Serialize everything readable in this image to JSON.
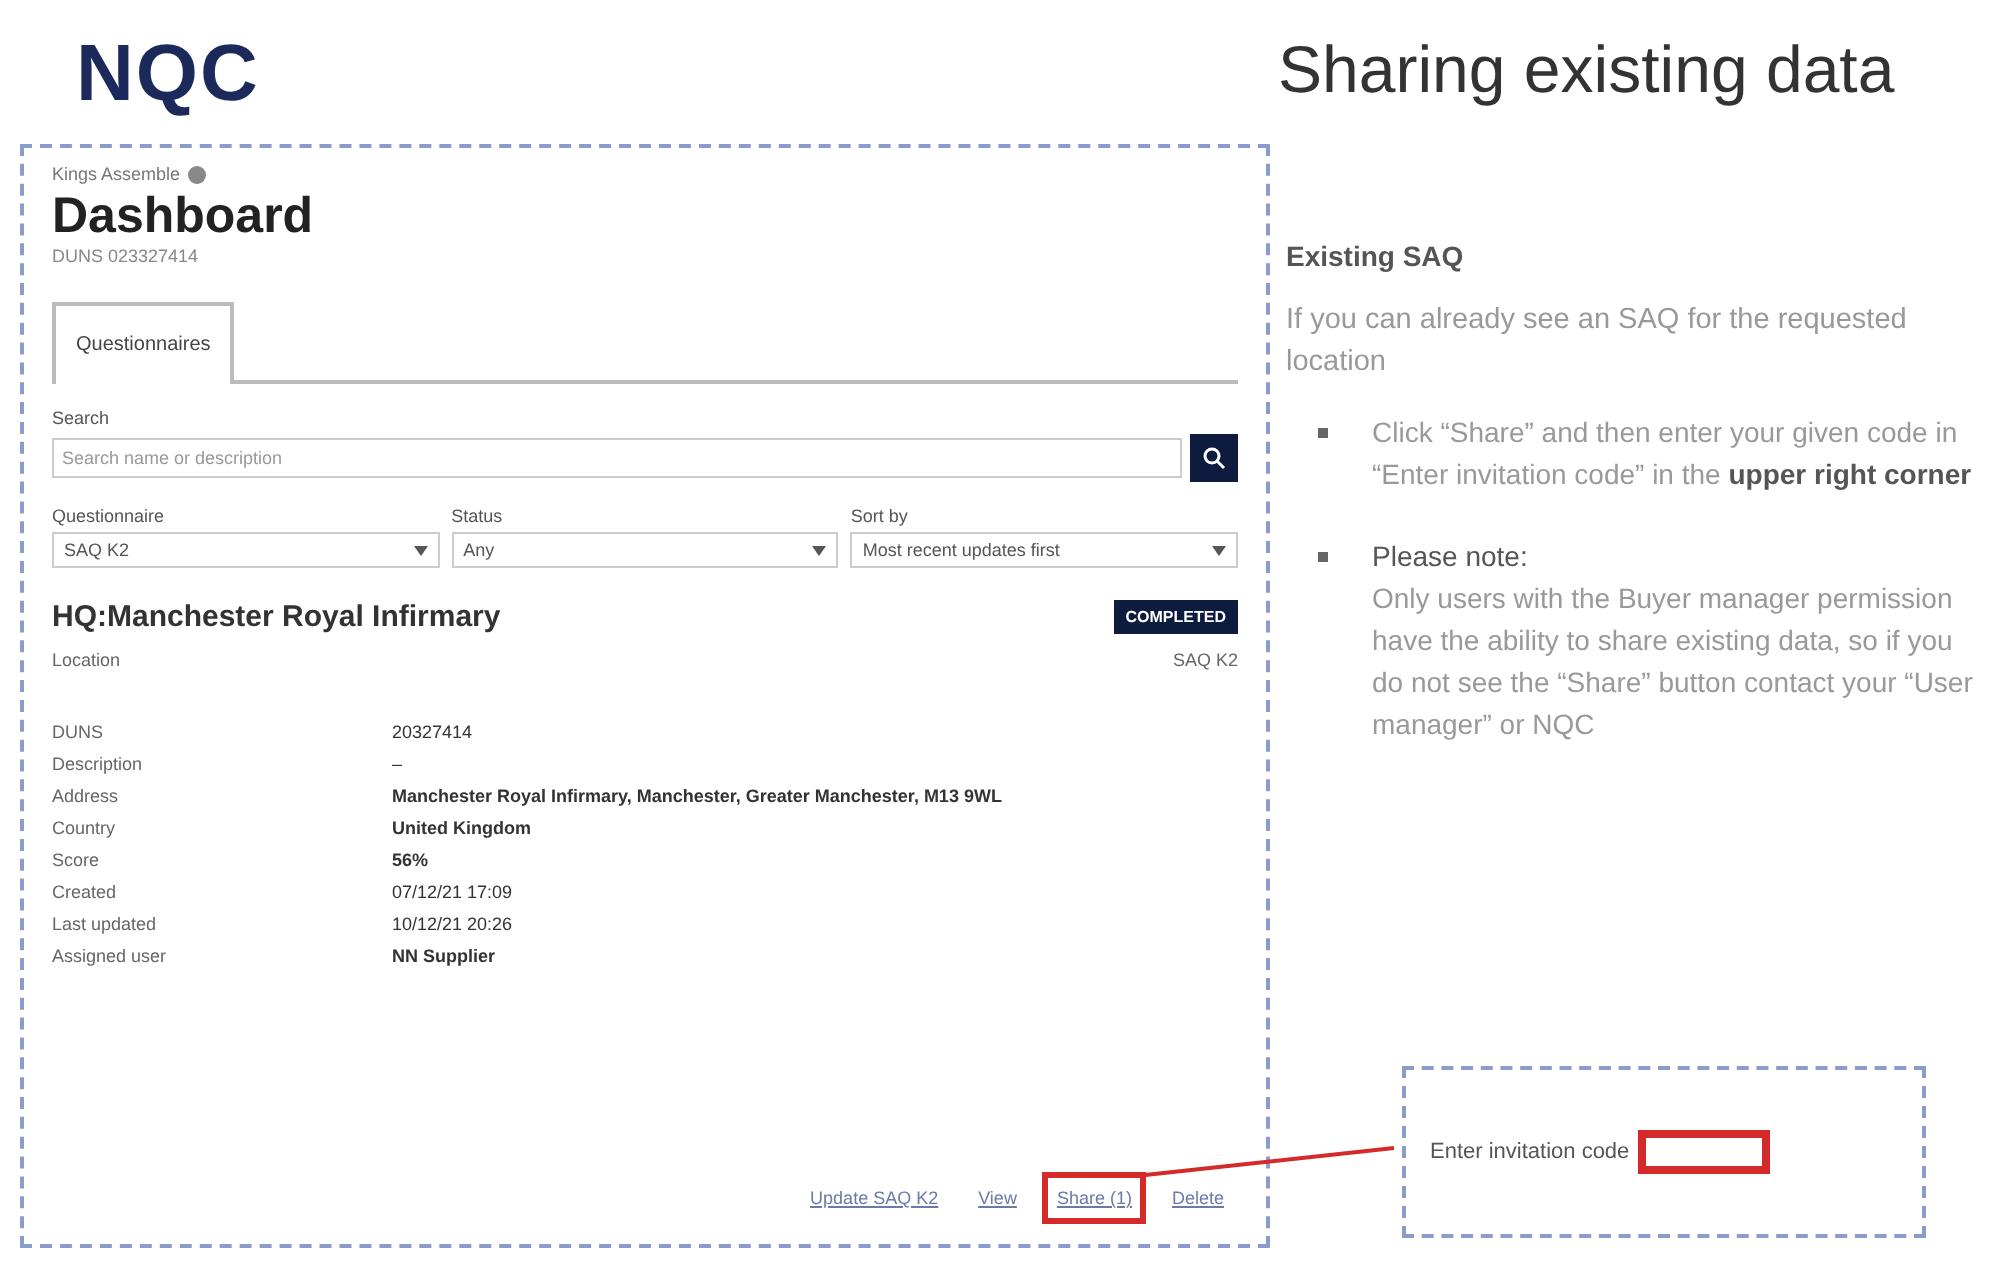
{
  "logo": "NQC",
  "slide_title": "Sharing existing data",
  "dashboard": {
    "breadcrumb": "Kings Assemble",
    "title": "Dashboard",
    "duns": "DUNS 023327414",
    "tabs": [
      {
        "label": "Questionnaires",
        "selected": true
      }
    ],
    "search": {
      "label": "Search",
      "placeholder": "Search name or description"
    },
    "filters": [
      {
        "label": "Questionnaire",
        "value": "SAQ K2"
      },
      {
        "label": "Status",
        "value": "Any"
      },
      {
        "label": "Sort by",
        "value": "Most recent updates first"
      }
    ],
    "card": {
      "title": "HQ:Manchester Royal Infirmary",
      "status": "COMPLETED",
      "subtitle": "Location",
      "type": "SAQ K2",
      "details": [
        {
          "label": "DUNS",
          "value": "20327414",
          "bold": false
        },
        {
          "label": "Description",
          "value": "–",
          "bold": false
        },
        {
          "label": "Address",
          "value": "Manchester Royal Infirmary, Manchester, Greater Manchester, M13 9WL",
          "bold": true
        },
        {
          "label": "Country",
          "value": "United Kingdom",
          "bold": true
        },
        {
          "label": "Score",
          "value": "56%",
          "bold": true
        },
        {
          "label": "Created",
          "value": "07/12/21 17:09",
          "bold": false
        },
        {
          "label": "Last updated",
          "value": "10/12/21 20:26",
          "bold": false
        },
        {
          "label": "Assigned user",
          "value": "NN Supplier",
          "bold": true
        }
      ],
      "actions": [
        {
          "label": "Update SAQ K2",
          "highlighted": false
        },
        {
          "label": "View",
          "highlighted": false
        },
        {
          "label": "Share (1)",
          "highlighted": true
        },
        {
          "label": "Delete",
          "highlighted": false
        }
      ]
    }
  },
  "explanation": {
    "heading": "Existing SAQ",
    "intro": "If you can already see an SAQ for the requested location",
    "bullets": [
      {
        "text": "Click “Share” and then enter your given code in “Enter invitation code” in the **upper right corner**"
      },
      {
        "title": "Please note:",
        "text": "Only users with the Buyer manager permission have the ability to share existing data, so if you do not see the “Share” button contact your “User manager” or NQC"
      }
    ]
  },
  "invitation": {
    "label": "Enter invitation code",
    "highlighted": true
  }
}
